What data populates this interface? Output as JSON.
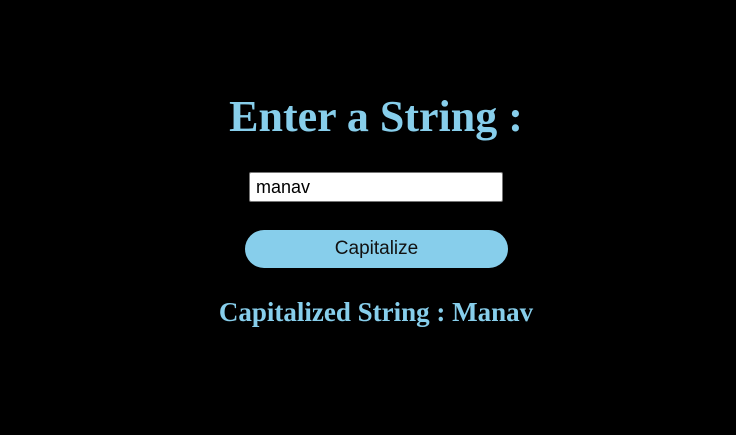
{
  "heading": "Enter a String :",
  "input": {
    "value": "manav",
    "placeholder": ""
  },
  "button_label": "Capitalize",
  "result": {
    "label": "Capitalized String : ",
    "value": "Manav"
  },
  "colors": {
    "background": "#000000",
    "accent": "#87CEEB",
    "button_text": "#111111"
  }
}
